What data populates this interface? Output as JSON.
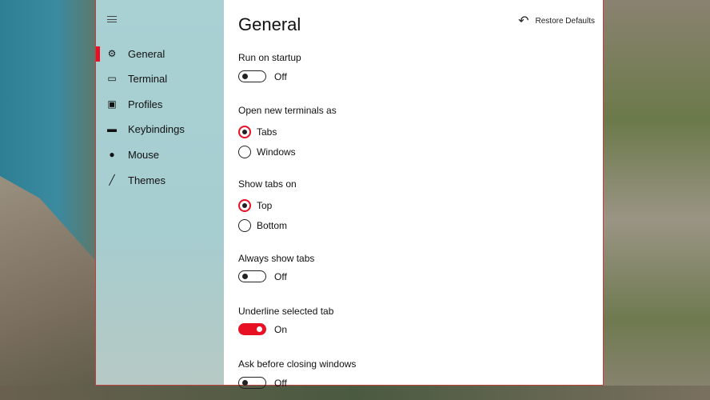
{
  "nav": {
    "items": [
      {
        "label": "General",
        "icon": "gear-icon",
        "glyph": "⚙"
      },
      {
        "label": "Terminal",
        "icon": "window-icon",
        "glyph": "▭"
      },
      {
        "label": "Profiles",
        "icon": "terminal-icon",
        "glyph": "▣"
      },
      {
        "label": "Keybindings",
        "icon": "keyboard-icon",
        "glyph": "▬"
      },
      {
        "label": "Mouse",
        "icon": "mouse-icon",
        "glyph": "●"
      },
      {
        "label": "Themes",
        "icon": "brush-icon",
        "glyph": "╱"
      }
    ]
  },
  "header": {
    "title": "General",
    "restore_label": "Restore Defaults",
    "restore_glyph": "↶"
  },
  "settings": {
    "run_on_startup": {
      "label": "Run on startup",
      "state": "Off"
    },
    "open_new_as": {
      "label": "Open new terminals as",
      "options": [
        "Tabs",
        "Windows"
      ],
      "selected": "Tabs"
    },
    "show_tabs_on": {
      "label": "Show tabs on",
      "options": [
        "Top",
        "Bottom"
      ],
      "selected": "Top"
    },
    "always_show_tabs": {
      "label": "Always show tabs",
      "state": "Off"
    },
    "underline_selected": {
      "label": "Underline selected tab",
      "state": "On"
    },
    "ask_before_closing": {
      "label": "Ask before closing windows",
      "state": "Off"
    }
  },
  "colors": {
    "accent": "#e81123"
  }
}
